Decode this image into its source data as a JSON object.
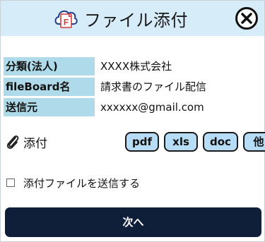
{
  "header": {
    "title": "ファイル添付",
    "app_icon_letter": "F"
  },
  "fields": [
    {
      "label": "分類(法人)",
      "value": "XXXX株式会社"
    },
    {
      "label": "fileBoard名",
      "value": "請求書のファイル配信"
    },
    {
      "label": "送信元",
      "value": "xxxxxx@gmail.com"
    }
  ],
  "attach": {
    "label": "添付",
    "types": [
      "pdf",
      "xls",
      "doc",
      "他"
    ]
  },
  "send_option": {
    "label": "添付ファイルを送信する",
    "checked": false
  },
  "next_button": {
    "label": "次へ"
  },
  "colors": {
    "header_bg": "#d6ecf8",
    "label_bg": "#aedaea",
    "type_button_bg": "#b7dcf6",
    "next_button_bg": "#0f1f3a"
  },
  "icons": [
    "app-icon",
    "close-icon",
    "paperclip-icon"
  ]
}
